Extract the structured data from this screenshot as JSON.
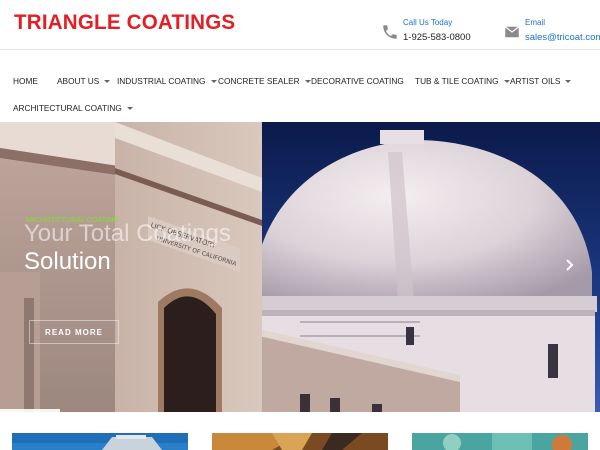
{
  "brand": {
    "logo_text": "TRIANGLE COATINGS",
    "color": "#e31e24"
  },
  "contact": {
    "phone": {
      "label": "Call Us Today",
      "value": "1-925-583-0800",
      "icon": "phone-icon"
    },
    "email": {
      "label": "Email",
      "value": "sales@tricoat.com",
      "icon": "envelope-icon"
    }
  },
  "nav": {
    "items": [
      {
        "label": "HOME",
        "has_dropdown": false
      },
      {
        "label": "ABOUT US",
        "has_dropdown": true
      },
      {
        "label": "INDUSTRIAL COATING",
        "has_dropdown": true
      },
      {
        "label": "CONCRETE SEALER",
        "has_dropdown": true
      },
      {
        "label": "DECORATIVE COATING",
        "has_dropdown": false
      },
      {
        "label": "TUB & TILE COATING",
        "has_dropdown": true
      },
      {
        "label": "ARTIST OILS",
        "has_dropdown": true
      },
      {
        "label": "ARCHITECTURAL COATING",
        "has_dropdown": true
      }
    ]
  },
  "hero": {
    "tag": "ARCHITECTURAL COATING",
    "headline_line1": "Your Total Coatings",
    "headline_line2": "Solution",
    "button_label": "READ MORE",
    "next_icon": "chevron-right-icon",
    "building_sign_line1": "LICK OBSERVATORY",
    "building_sign_line2": "UNIVERSITY OF CALIFORNIA",
    "tag_color": "#7fe02e"
  },
  "thumbnails": [
    {
      "name": "thumbnail-industrial"
    },
    {
      "name": "thumbnail-rust"
    },
    {
      "name": "thumbnail-decorative"
    }
  ]
}
